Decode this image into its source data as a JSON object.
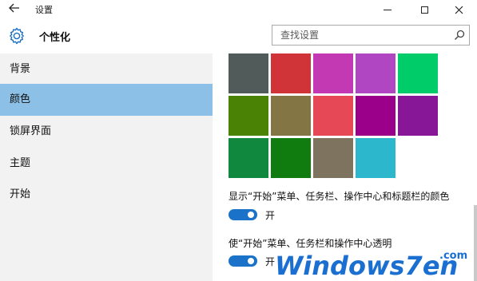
{
  "titlebar": {
    "back_icon": "back-arrow-icon",
    "title": "设置",
    "minimize_icon": "minimize-icon",
    "maximize_icon": "maximize-icon",
    "close_icon": "close-icon"
  },
  "header": {
    "icon": "gear-icon",
    "title": "个性化",
    "search_placeholder": "查找设置",
    "search_icon": "search-icon"
  },
  "sidebar": {
    "items": [
      {
        "label": "背景",
        "active": false
      },
      {
        "label": "颜色",
        "active": true
      },
      {
        "label": "锁屏界面",
        "active": false
      },
      {
        "label": "主题",
        "active": false
      },
      {
        "label": "开始",
        "active": false
      }
    ]
  },
  "palette": {
    "colors": [
      "#515c5a",
      "#d13438",
      "#c239b3",
      "#b146c2",
      "#00cc6a",
      "#498205",
      "#847545",
      "#e74856",
      "#9a0089",
      "#881798",
      "#10893e",
      "#107c10",
      "#7e735f",
      "#2cb7cc"
    ]
  },
  "options": {
    "show_color_label": "显示“开始”菜单、任务栏、操作中心和标题栏的颜色",
    "show_color_toggle_label": "开",
    "show_color_on": true,
    "transparent_label": "使“开始”菜单、任务栏和操作中心透明",
    "transparent_toggle_label": "开",
    "transparent_on": true
  },
  "watermark": {
    "text": "Windows7en",
    "suffix": ".com",
    "color": "#1a6fd1"
  },
  "colors": {
    "accent": "#1a73c9",
    "sidebar_bg": "#f2f2f2",
    "sidebar_active": "#8cc0e6"
  }
}
